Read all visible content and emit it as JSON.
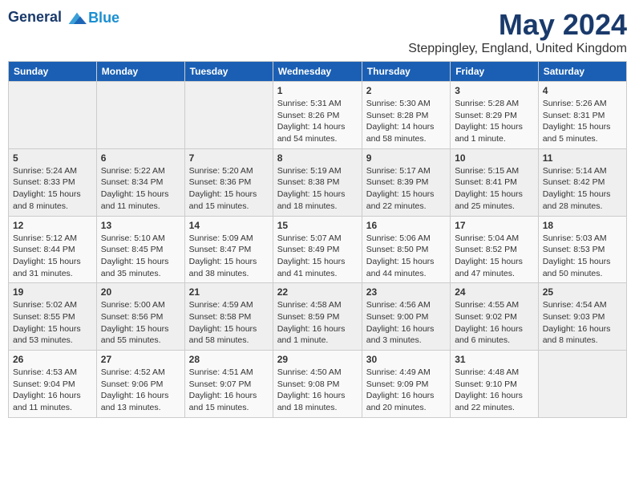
{
  "header": {
    "logo_line1": "General",
    "logo_line2": "Blue",
    "month_year": "May 2024",
    "location": "Steppingley, England, United Kingdom"
  },
  "weekdays": [
    "Sunday",
    "Monday",
    "Tuesday",
    "Wednesday",
    "Thursday",
    "Friday",
    "Saturday"
  ],
  "weeks": [
    [
      {
        "day": "",
        "info": ""
      },
      {
        "day": "",
        "info": ""
      },
      {
        "day": "",
        "info": ""
      },
      {
        "day": "1",
        "info": "Sunrise: 5:31 AM\nSunset: 8:26 PM\nDaylight: 14 hours\nand 54 minutes."
      },
      {
        "day": "2",
        "info": "Sunrise: 5:30 AM\nSunset: 8:28 PM\nDaylight: 14 hours\nand 58 minutes."
      },
      {
        "day": "3",
        "info": "Sunrise: 5:28 AM\nSunset: 8:29 PM\nDaylight: 15 hours\nand 1 minute."
      },
      {
        "day": "4",
        "info": "Sunrise: 5:26 AM\nSunset: 8:31 PM\nDaylight: 15 hours\nand 5 minutes."
      }
    ],
    [
      {
        "day": "5",
        "info": "Sunrise: 5:24 AM\nSunset: 8:33 PM\nDaylight: 15 hours\nand 8 minutes."
      },
      {
        "day": "6",
        "info": "Sunrise: 5:22 AM\nSunset: 8:34 PM\nDaylight: 15 hours\nand 11 minutes."
      },
      {
        "day": "7",
        "info": "Sunrise: 5:20 AM\nSunset: 8:36 PM\nDaylight: 15 hours\nand 15 minutes."
      },
      {
        "day": "8",
        "info": "Sunrise: 5:19 AM\nSunset: 8:38 PM\nDaylight: 15 hours\nand 18 minutes."
      },
      {
        "day": "9",
        "info": "Sunrise: 5:17 AM\nSunset: 8:39 PM\nDaylight: 15 hours\nand 22 minutes."
      },
      {
        "day": "10",
        "info": "Sunrise: 5:15 AM\nSunset: 8:41 PM\nDaylight: 15 hours\nand 25 minutes."
      },
      {
        "day": "11",
        "info": "Sunrise: 5:14 AM\nSunset: 8:42 PM\nDaylight: 15 hours\nand 28 minutes."
      }
    ],
    [
      {
        "day": "12",
        "info": "Sunrise: 5:12 AM\nSunset: 8:44 PM\nDaylight: 15 hours\nand 31 minutes."
      },
      {
        "day": "13",
        "info": "Sunrise: 5:10 AM\nSunset: 8:45 PM\nDaylight: 15 hours\nand 35 minutes."
      },
      {
        "day": "14",
        "info": "Sunrise: 5:09 AM\nSunset: 8:47 PM\nDaylight: 15 hours\nand 38 minutes."
      },
      {
        "day": "15",
        "info": "Sunrise: 5:07 AM\nSunset: 8:49 PM\nDaylight: 15 hours\nand 41 minutes."
      },
      {
        "day": "16",
        "info": "Sunrise: 5:06 AM\nSunset: 8:50 PM\nDaylight: 15 hours\nand 44 minutes."
      },
      {
        "day": "17",
        "info": "Sunrise: 5:04 AM\nSunset: 8:52 PM\nDaylight: 15 hours\nand 47 minutes."
      },
      {
        "day": "18",
        "info": "Sunrise: 5:03 AM\nSunset: 8:53 PM\nDaylight: 15 hours\nand 50 minutes."
      }
    ],
    [
      {
        "day": "19",
        "info": "Sunrise: 5:02 AM\nSunset: 8:55 PM\nDaylight: 15 hours\nand 53 minutes."
      },
      {
        "day": "20",
        "info": "Sunrise: 5:00 AM\nSunset: 8:56 PM\nDaylight: 15 hours\nand 55 minutes."
      },
      {
        "day": "21",
        "info": "Sunrise: 4:59 AM\nSunset: 8:58 PM\nDaylight: 15 hours\nand 58 minutes."
      },
      {
        "day": "22",
        "info": "Sunrise: 4:58 AM\nSunset: 8:59 PM\nDaylight: 16 hours\nand 1 minute."
      },
      {
        "day": "23",
        "info": "Sunrise: 4:56 AM\nSunset: 9:00 PM\nDaylight: 16 hours\nand 3 minutes."
      },
      {
        "day": "24",
        "info": "Sunrise: 4:55 AM\nSunset: 9:02 PM\nDaylight: 16 hours\nand 6 minutes."
      },
      {
        "day": "25",
        "info": "Sunrise: 4:54 AM\nSunset: 9:03 PM\nDaylight: 16 hours\nand 8 minutes."
      }
    ],
    [
      {
        "day": "26",
        "info": "Sunrise: 4:53 AM\nSunset: 9:04 PM\nDaylight: 16 hours\nand 11 minutes."
      },
      {
        "day": "27",
        "info": "Sunrise: 4:52 AM\nSunset: 9:06 PM\nDaylight: 16 hours\nand 13 minutes."
      },
      {
        "day": "28",
        "info": "Sunrise: 4:51 AM\nSunset: 9:07 PM\nDaylight: 16 hours\nand 15 minutes."
      },
      {
        "day": "29",
        "info": "Sunrise: 4:50 AM\nSunset: 9:08 PM\nDaylight: 16 hours\nand 18 minutes."
      },
      {
        "day": "30",
        "info": "Sunrise: 4:49 AM\nSunset: 9:09 PM\nDaylight: 16 hours\nand 20 minutes."
      },
      {
        "day": "31",
        "info": "Sunrise: 4:48 AM\nSunset: 9:10 PM\nDaylight: 16 hours\nand 22 minutes."
      },
      {
        "day": "",
        "info": ""
      }
    ]
  ]
}
